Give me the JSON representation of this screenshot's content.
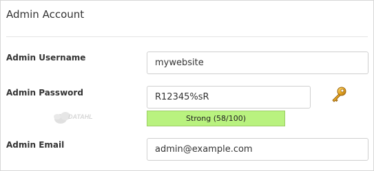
{
  "panel": {
    "title": "Admin Account"
  },
  "username": {
    "label": "Admin Username",
    "value": "mywebsite"
  },
  "password": {
    "label": "Admin Password",
    "value": "R12345%sR",
    "generate_icon": "key-icon",
    "strength": {
      "text": "Strong (58/100)",
      "score": 58,
      "max": 100,
      "fill_fraction": 1.0
    }
  },
  "email": {
    "label": "Admin Email",
    "value": "admin@example.com"
  },
  "watermark": {
    "text": "DATAHL"
  },
  "colors": {
    "strength_fill": "#b9f27f",
    "strength_border": "#9ccc65",
    "key_gold": "#e0a020"
  }
}
